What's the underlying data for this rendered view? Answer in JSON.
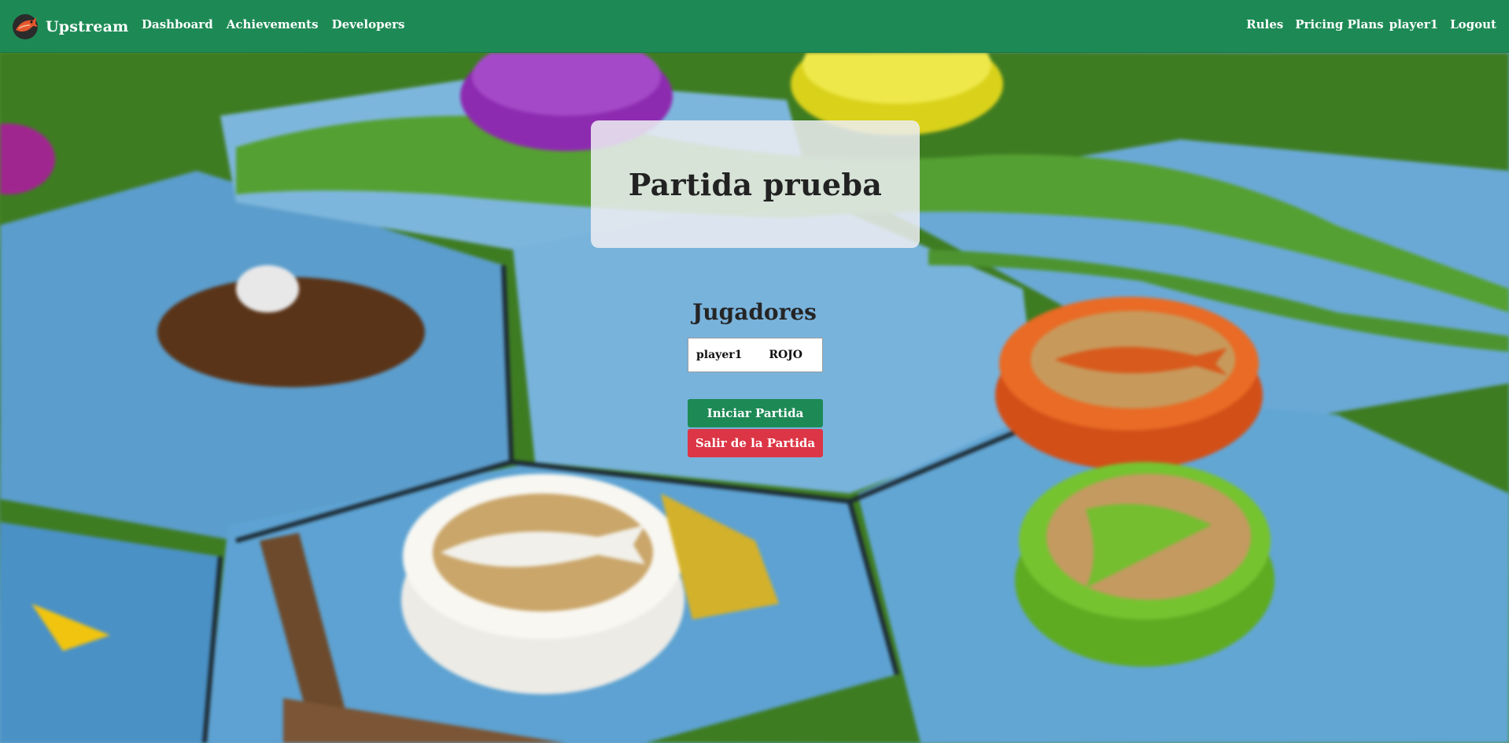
{
  "navbar": {
    "brand": "Upstream",
    "left_links": [
      "Dashboard",
      "Achievements",
      "Developers"
    ],
    "right_links": [
      "Rules",
      "Pricing Plans"
    ],
    "user": "player1",
    "logout": "Logout",
    "color": "#1d8a55"
  },
  "game": {
    "title": "Partida prueba",
    "players_heading": "Jugadores",
    "players": [
      {
        "name": "player1",
        "color": "ROJO"
      }
    ],
    "start_button": "Iniciar Partida",
    "leave_button": "Salir de la Partida"
  },
  "colors": {
    "primary": "#1d8a55",
    "danger": "#dc3545"
  },
  "icons": {
    "brand": "salmon-logo-icon"
  }
}
